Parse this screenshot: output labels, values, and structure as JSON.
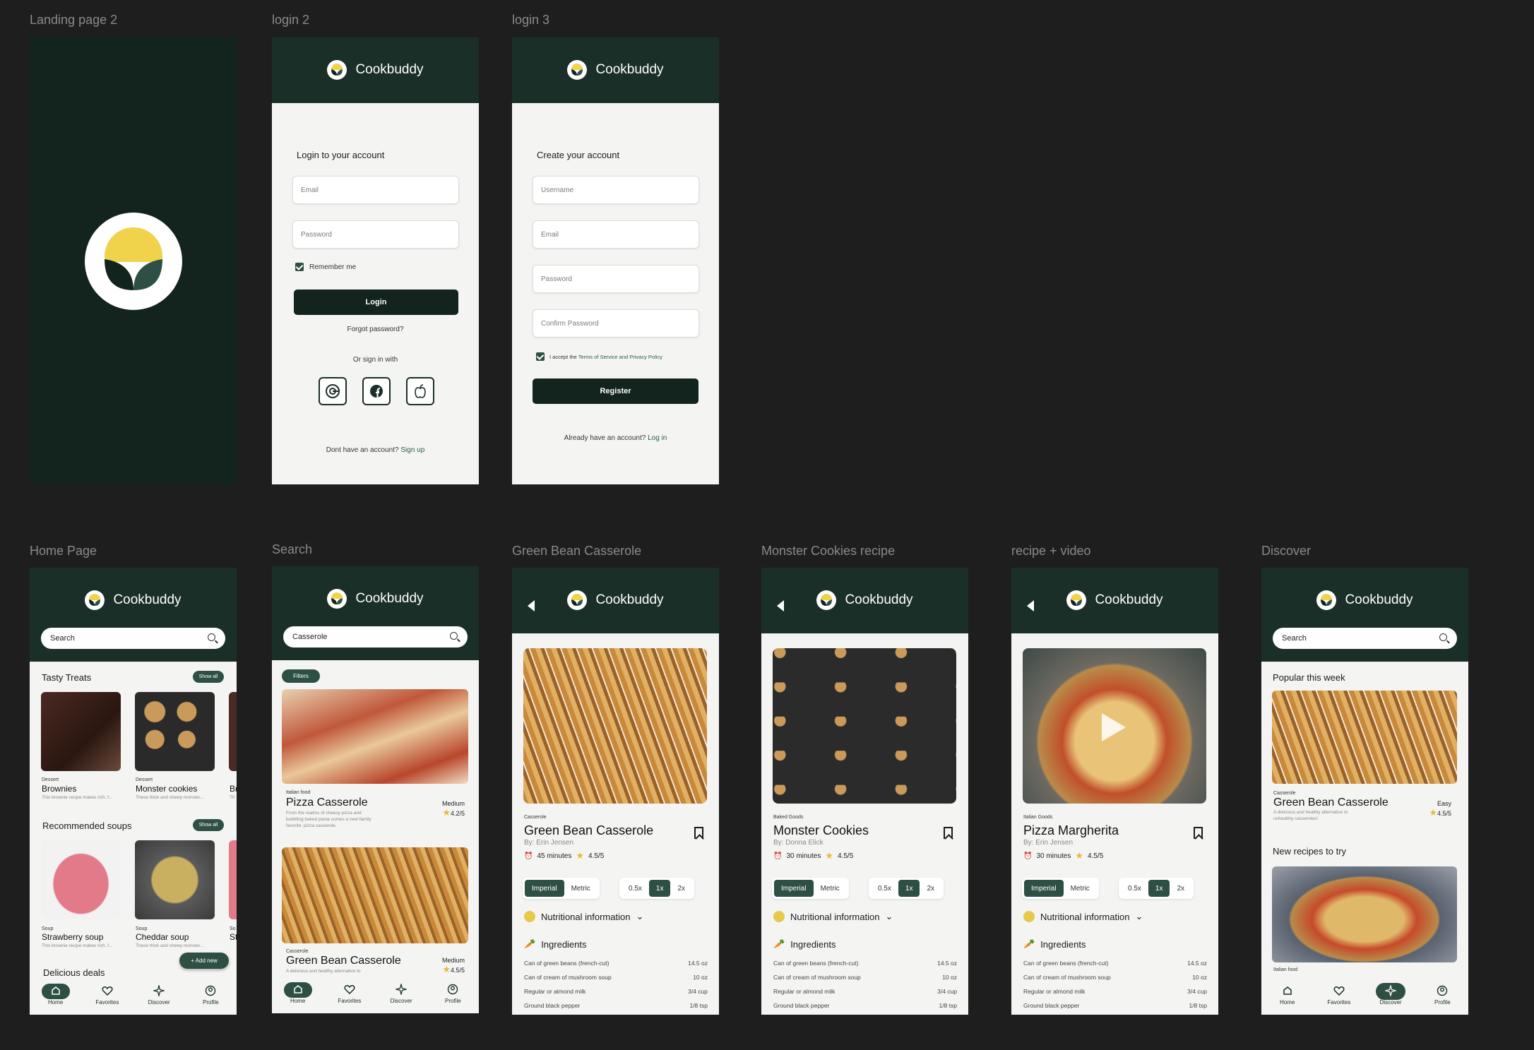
{
  "frame_labels": {
    "landing": "Landing page 2",
    "login2": "login 2",
    "login3": "login 3",
    "home": "Home Page",
    "search": "Search",
    "gbc": "Green Bean Casserole",
    "monster": "Monster Cookies recipe",
    "video": "recipe + video",
    "discover": "Discover"
  },
  "brand": "Cookbuddy",
  "colors": {
    "dark_green": "#1a2f27",
    "accent_green": "#2e4f43",
    "yellow": "#f0d24b"
  },
  "login": {
    "heading": "Login to your account",
    "email_placeholder": "Email",
    "password_placeholder": "Password",
    "remember": "Remember me",
    "login_button": "Login",
    "forgot": "Forgot password?",
    "or_sign": "Or sign in with",
    "no_account": "Dont have an account?",
    "sign_up": "Sign up",
    "social_icons": [
      "google-icon",
      "facebook-icon",
      "apple-icon"
    ]
  },
  "register": {
    "heading": "Create your account",
    "username_placeholder": "Username",
    "email_placeholder": "Email",
    "password_placeholder": "Password",
    "confirm_placeholder": "Confirm Password",
    "terms_prefix": "I accept the",
    "terms_link": "Terms of Service and Privacy Policy",
    "register_button": "Register",
    "already": "Already have an account?",
    "login_link": "Log in"
  },
  "home": {
    "search_placeholder": "Search",
    "section1": "Tasty Treats",
    "section2": "Recommended soups",
    "section3": "Delicious deals",
    "show_all": "Show all",
    "add_new": "+ Add new",
    "treats": [
      {
        "category": "Dessert",
        "title": "Brownies",
        "desc": "This brownie recipe makes rich, f..."
      },
      {
        "category": "Dessert",
        "title": "Monster cookies",
        "desc": "These thick and chewy monster..."
      },
      {
        "category": "",
        "title": "Br",
        "desc": "Th"
      }
    ],
    "soups": [
      {
        "category": "Soup",
        "title": "Strawberry soup",
        "desc": "This brownie recipe makes rich, f..."
      },
      {
        "category": "Soup",
        "title": "Cheddar soup",
        "desc": "These thick and chewy monster..."
      },
      {
        "category": "So",
        "title": "St",
        "desc": "Th"
      }
    ]
  },
  "nav": {
    "home": "Home",
    "favorites": "Favorites",
    "discover": "Discover",
    "profile": "Profile"
  },
  "search_page": {
    "query": "Casserole",
    "filters": "Filters",
    "results": [
      {
        "category": "Italian food",
        "title": "Pizza Casserole",
        "difficulty": "Medium",
        "rating": "4.2/5",
        "desc": [
          "From the realms of cheesy pizza and",
          "bubbling baked pasta comes a new family",
          "favorite: pizza casserole."
        ]
      },
      {
        "category": "Casserole",
        "title": "Green Bean Casserole",
        "difficulty": "Medium",
        "rating": "4.5/5",
        "desc": [
          "A delicious and healthy alternative to"
        ]
      }
    ]
  },
  "recipes": [
    {
      "category": "Casserole",
      "title": "Green Bean Casserole",
      "by": "By: Erin Jensen",
      "time": "45 minutes",
      "rating": "4.5/5"
    },
    {
      "category": "Baked Goods",
      "title": "Monster Cookies",
      "by": "By: Donna Elick",
      "time": "30 minutes",
      "rating": "4.5/5"
    },
    {
      "category": "Italian Goods",
      "title": "Pizza Margherita",
      "by": "By: Erin Jensen",
      "time": "30 minutes",
      "rating": "4.5/5"
    }
  ],
  "units": {
    "imperial": "Imperial",
    "metric": "Metric",
    "half": "0.5x",
    "one": "1x",
    "two": "2x"
  },
  "nutrition": "Nutritional information",
  "ingredients_heading": "Ingredients",
  "ingredients": [
    {
      "name": "Can of green beans (french-cut)",
      "qty": "14.5 oz"
    },
    {
      "name": "Can of cream of mushroom soup",
      "qty": "10 oz"
    },
    {
      "name": "Regular or almond milk",
      "qty": "3/4 cup"
    },
    {
      "name": "Ground black pepper",
      "qty": "1/8 tsp"
    }
  ],
  "discover": {
    "search_placeholder": "Search",
    "popular": "Popular this week",
    "popular_item": {
      "category": "Casserole",
      "title": "Green Bean Casserole",
      "difficulty": "Easy",
      "rating": "4.5/5",
      "desc": [
        "A delicious and healthy alternative to",
        "unhealthy casseroles!"
      ]
    },
    "new_recipes": "New recipes to try",
    "new_item_category": "Italian food"
  }
}
